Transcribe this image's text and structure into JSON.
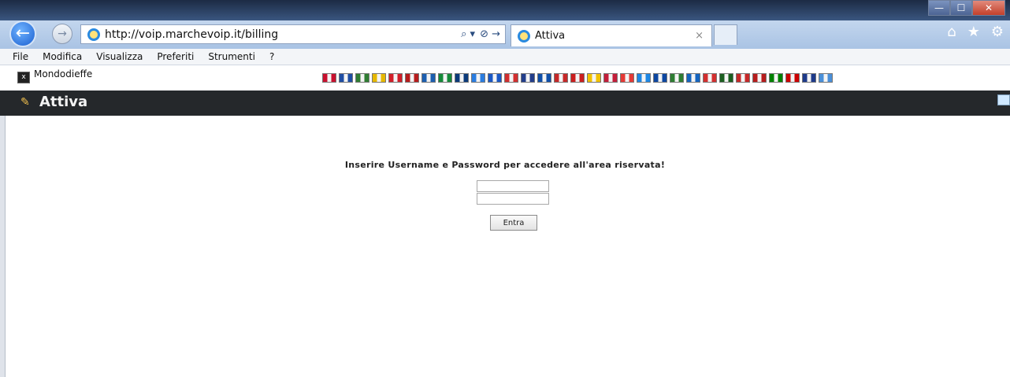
{
  "browser": {
    "url": "http://voip.marchevoip.it/billing",
    "tab_title": "Attiva",
    "back_glyph": "←",
    "forward_glyph": "→",
    "close_tab_glyph": "×",
    "window_buttons": [
      "—",
      "☐",
      "✕"
    ],
    "right_tools": [
      "⌂",
      "★",
      "⚙"
    ],
    "addr_tools": [
      "⌕ ▾",
      "⊘ →"
    ]
  },
  "menu": [
    "File",
    "Modifica",
    "Visualizza",
    "Preferiti",
    "Strumenti",
    "?"
  ],
  "favorites": {
    "label": "Mondodieffe"
  },
  "flags": [
    "#c8102e",
    "#1f4ea3",
    "#2f7d32",
    "#e6b800",
    "#d21f2a",
    "#b71c1c",
    "#1d5fb0",
    "#168a3a",
    "#0b3a7a",
    "#2b7de0",
    "#1a58c5",
    "#d22f2f",
    "#233e8b",
    "#0f4fa8",
    "#c62828",
    "#cc1f1f",
    "#f2c200",
    "#c41e3a",
    "#e53935",
    "#1e88e5",
    "#0d47a1",
    "#2e7d32",
    "#1565c0",
    "#d32f2f",
    "#1b5e20",
    "#c62828",
    "#b71c1c",
    "#008000",
    "#cc0000",
    "#1e3a8a",
    "#4a90d9"
  ],
  "header": {
    "title": "Attiva",
    "icon": "pencil-icon"
  },
  "login": {
    "instruction": "Inserire Username e Password per accedere all'area riservata!",
    "username_value": "",
    "password_value": "",
    "button_label": "Entra"
  },
  "colors": {
    "header_bg": "#25282b",
    "accent": "#1a5fd0"
  }
}
